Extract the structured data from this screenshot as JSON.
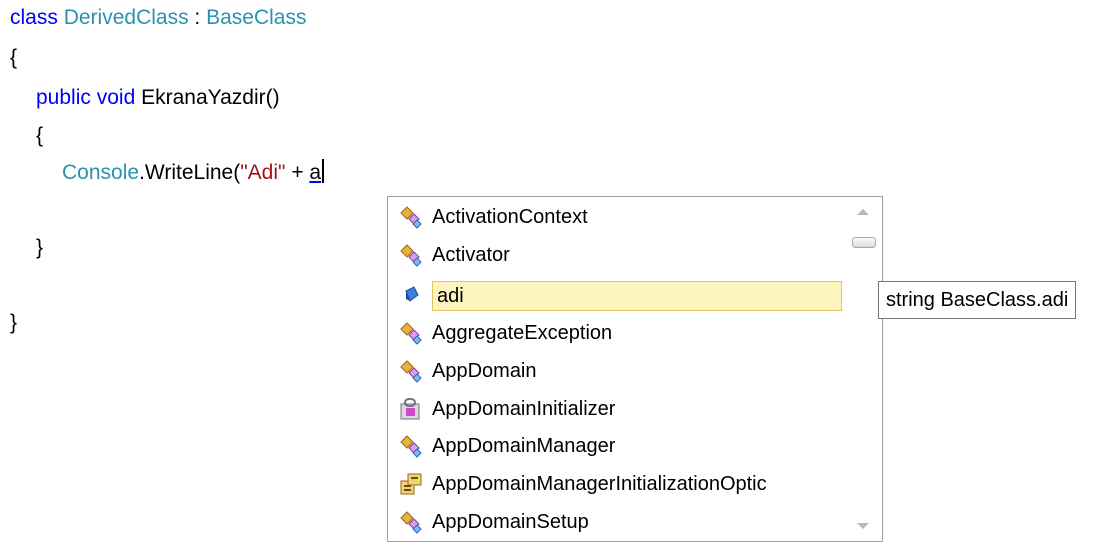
{
  "code": {
    "line1": {
      "kw": "class",
      "name": "DerivedClass",
      "sep": " : ",
      "base": "BaseClass"
    },
    "open1": "{",
    "line3": {
      "kw1": "public",
      "kw2": "void",
      "method": "EkranaYazdir()"
    },
    "open2": "{",
    "line5": {
      "type": "Console",
      "call": ".WriteLine(",
      "str": "\"Adi\"",
      "op": " + ",
      "typed": "a"
    },
    "close2": "}",
    "close1": "}"
  },
  "completion": {
    "items": [
      {
        "label": "ActivationContext",
        "icon": "class-icon"
      },
      {
        "label": "Activator",
        "icon": "class-icon"
      },
      {
        "label": "adi",
        "icon": "field-icon",
        "selected": true
      },
      {
        "label": "AggregateException",
        "icon": "class-icon"
      },
      {
        "label": "AppDomain",
        "icon": "class-icon"
      },
      {
        "label": "AppDomainInitializer",
        "icon": "delegate-icon"
      },
      {
        "label": "AppDomainManager",
        "icon": "class-icon"
      },
      {
        "label": "AppDomainManagerInitializationOptic",
        "icon": "enum-icon"
      },
      {
        "label": "AppDomainSetup",
        "icon": "class-icon"
      }
    ]
  },
  "tooltip": {
    "text": "string BaseClass.adi"
  },
  "colors": {
    "keyword": "#0000ff",
    "type": "#2b91af",
    "string": "#a31515",
    "selection": "#fdf4bf"
  }
}
